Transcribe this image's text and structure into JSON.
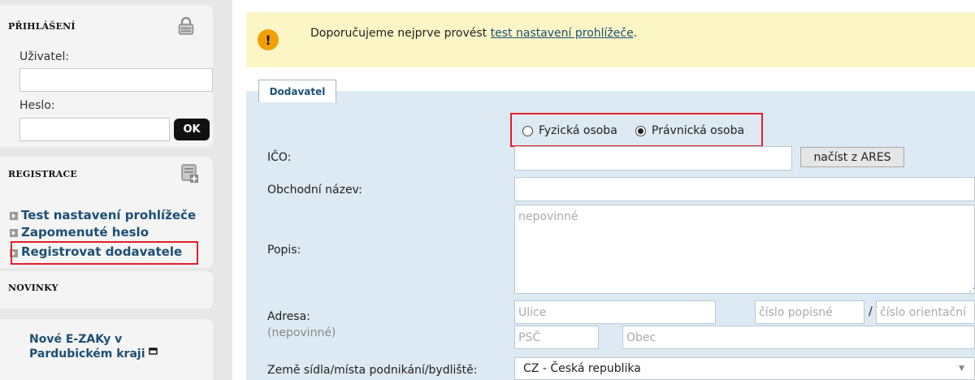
{
  "sidebar": {
    "login": {
      "title": "PŘIHLÁŠENÍ",
      "icon": "lock-icon",
      "user_label": "Uživatel:",
      "password_label": "Heslo:",
      "ok_label": "OK"
    },
    "registration": {
      "title": "REGISTRACE",
      "icon": "add-user-icon",
      "links": [
        "Test nastavení prohlížeče",
        "Zapomenuté heslo",
        "Registrovat dodavatele"
      ]
    },
    "news": {
      "title": "NOVINKY",
      "item_line1": "Nové E-ZAKy v",
      "item_line2": "Pardubickém kraji"
    }
  },
  "notice": {
    "text": "Doporučujeme nejprve provést ",
    "link": "test nastavení prohlížeče",
    "suffix": "."
  },
  "form": {
    "tab": "Dodavatel",
    "radio_person": "Fyzická osoba",
    "radio_company": "Právnická osoba",
    "selected": "Právnická osoba",
    "ico_label": "IČO:",
    "ares_button": "načíst z ARES",
    "name_label": "Obchodní název:",
    "desc_label": "Popis:",
    "desc_placeholder": "nepovinné",
    "address_label": "Adresa:",
    "address_optional": "(nepovinné)",
    "street_placeholder": "Ulice",
    "house_no_placeholder": "číslo popisné",
    "separator": "/",
    "orient_no_placeholder": "číslo orientační",
    "zip_placeholder": "PSČ",
    "city_placeholder": "Obec",
    "country_label": "Země sídla/místa podnikání/bydliště:",
    "country_value": "CZ - Česká republika"
  },
  "colors": {
    "link": "#1d4f73",
    "highlight": "#e0202a",
    "notice_bg": "#fcf6c7",
    "form_bg": "#dde9f3"
  }
}
